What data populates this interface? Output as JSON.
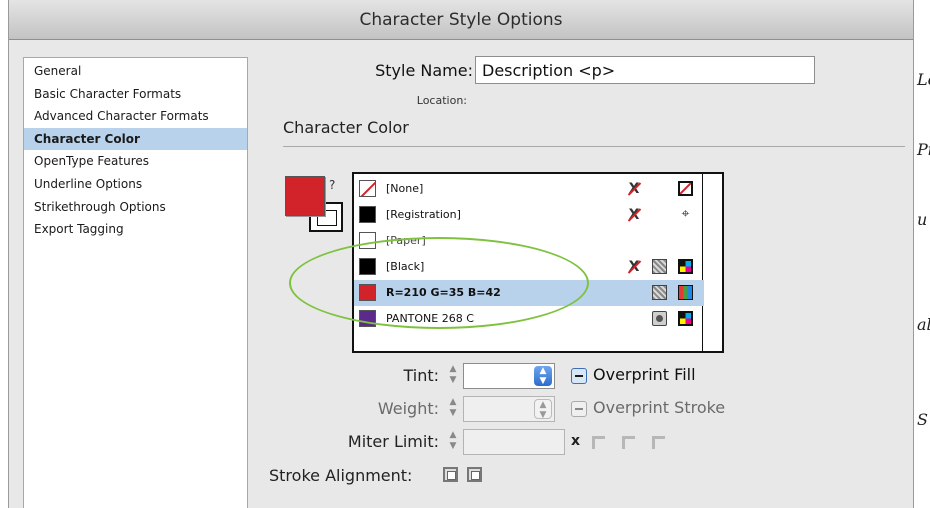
{
  "window": {
    "title": "Character Style Options"
  },
  "sidebar": {
    "items": [
      {
        "label": "General"
      },
      {
        "label": "Basic Character Formats"
      },
      {
        "label": "Advanced Character Formats"
      },
      {
        "label": "Character Color",
        "selected": true
      },
      {
        "label": "OpenType Features"
      },
      {
        "label": "Underline Options"
      },
      {
        "label": "Strikethrough Options"
      },
      {
        "label": "Export Tagging"
      }
    ]
  },
  "style_name": {
    "label": "Style Name:",
    "value": "Description <p>"
  },
  "location": {
    "label": "Location:"
  },
  "section": {
    "title": "Character Color"
  },
  "proxy": {
    "swap_glyph": "?",
    "fill_color": "#d2232a"
  },
  "swatches": [
    {
      "name": "[None]",
      "chip": "none",
      "locked": true,
      "mode": "none"
    },
    {
      "name": "[Registration]",
      "chip": "#000000",
      "locked": true,
      "mode": "registration"
    },
    {
      "name": "[Paper]",
      "chip": "#ffffff",
      "locked": false,
      "mode": ""
    },
    {
      "name": "[Black]",
      "chip": "#000000",
      "locked": true,
      "mode": "process-cmyk"
    },
    {
      "name": "R=210 G=35 B=42",
      "chip": "#d2232a",
      "locked": false,
      "mode": "process-rgb",
      "selected": true
    },
    {
      "name": "PANTONE 268 C",
      "chip": "#5b2a8c",
      "locked": false,
      "mode": "spot-cmyk"
    }
  ],
  "controls": {
    "tint": {
      "label": "Tint:",
      "value": ""
    },
    "weight": {
      "label": "Weight:",
      "value": ""
    },
    "miter_limit": {
      "label": "Miter Limit:",
      "value": "",
      "x_glyph": "x"
    },
    "stroke_alignment": {
      "label": "Stroke Alignment:"
    },
    "overprint_fill": {
      "label": "Overprint Fill"
    },
    "overprint_stroke": {
      "label": "Overprint Stroke"
    }
  },
  "colors": {
    "selection": "#b9d2ec",
    "annotation": "#7ec23f"
  },
  "background": {
    "glyphs": [
      "Lc",
      "Pi",
      "u",
      "al",
      "S"
    ]
  }
}
